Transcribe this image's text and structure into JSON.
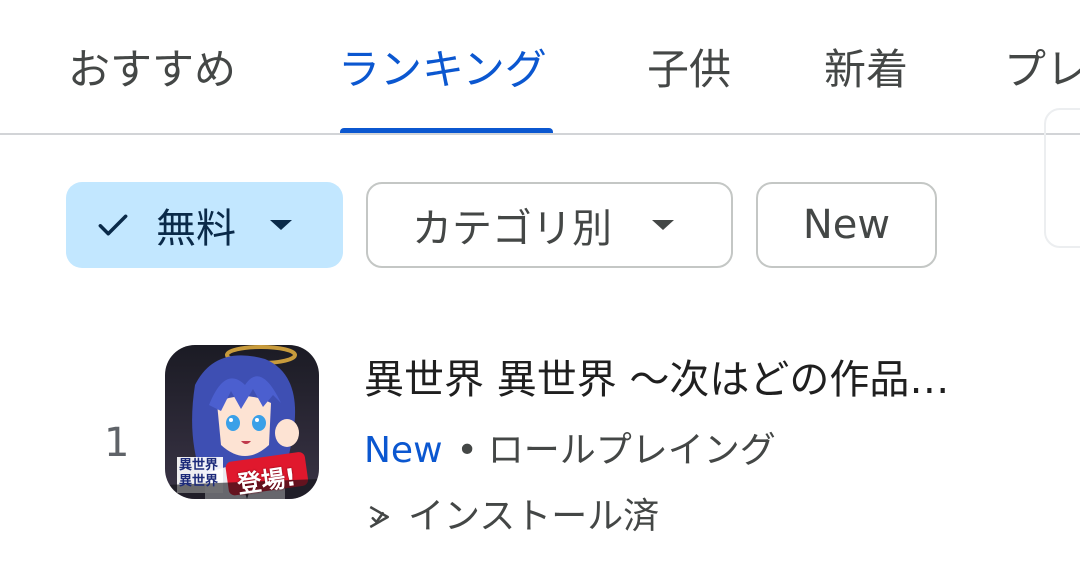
{
  "tabs": [
    {
      "label": "おすすめ"
    },
    {
      "label": "ランキング"
    },
    {
      "label": "子供"
    },
    {
      "label": "新着"
    },
    {
      "label": "プレ"
    }
  ],
  "active_tab_index": 1,
  "filters": {
    "price": {
      "label": "無料",
      "checked": true
    },
    "category": {
      "label": "カテゴリ別"
    },
    "new": {
      "label": "New"
    }
  },
  "app": {
    "rank": "1",
    "title": "異世界 異世界 〜次はどの作品…",
    "badge_new": "New",
    "separator": "•",
    "genre": "ロールプレイング",
    "installed_status": "インストール済",
    "icon_logo_line1": "異世界",
    "icon_logo_line2": "異世界",
    "icon_banner": "登場!"
  },
  "colors": {
    "accent": "#0b57d0",
    "chip_selected_bg": "#c2e7ff",
    "chip_border": "#c4c7c5"
  },
  "icons": [
    "check-icon",
    "dropdown-caret-icon",
    "installed-icon"
  ]
}
